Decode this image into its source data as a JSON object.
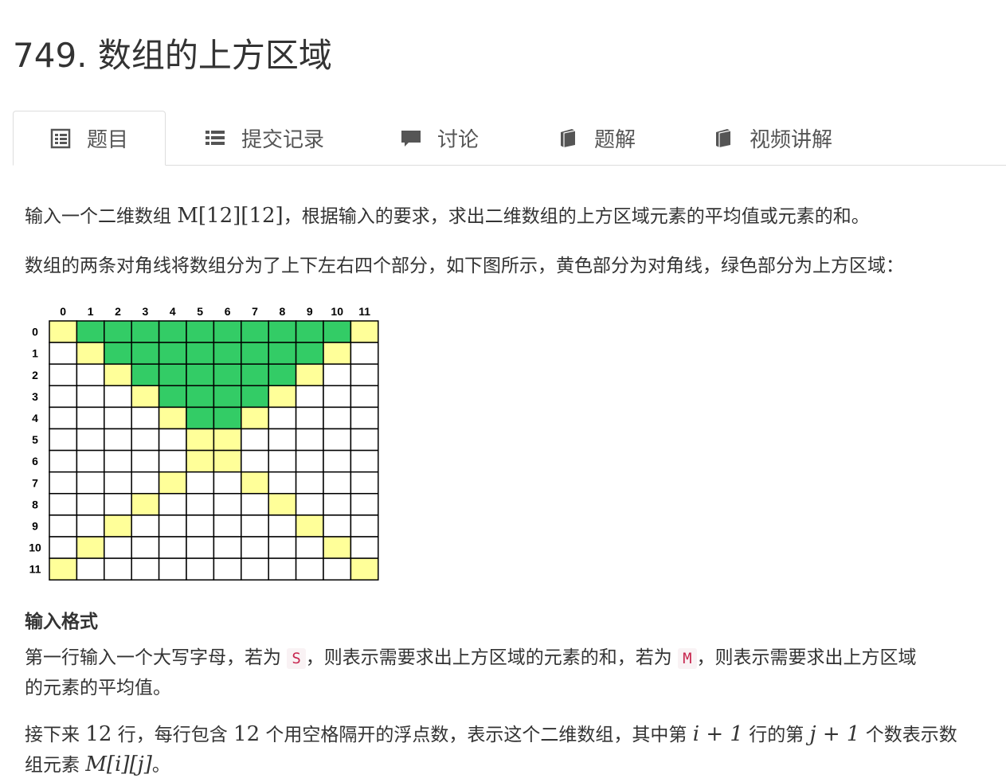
{
  "page": {
    "title": "749. 数组的上方区域"
  },
  "tabs": [
    {
      "label": "题目",
      "icon": "document-icon",
      "active": true
    },
    {
      "label": "提交记录",
      "icon": "list-icon",
      "active": false
    },
    {
      "label": "讨论",
      "icon": "comment-icon",
      "active": false
    },
    {
      "label": "题解",
      "icon": "book-icon",
      "active": false
    },
    {
      "label": "视频讲解",
      "icon": "book-icon",
      "active": false
    }
  ],
  "problem": {
    "p1_before": "输入一个二维数组 ",
    "p1_math": "M[12][12]",
    "p1_after": "，根据输入的要求，求出二维数组的上方区域元素的平均值或元素的和。",
    "p2": "数组的两条对角线将数组分为了上下左右四个部分，如下图所示，黄色部分为对角线，绿色部分为上方区域：",
    "input_heading": "输入格式",
    "p3_a": "第一行输入一个大写字母，若为 ",
    "p3_code1": "S",
    "p3_b": "，则表示需要求出上方区域的元素的和，若为 ",
    "p3_code2": "M",
    "p3_c": "，则表示需要求出上方区域",
    "p3_d": "的元素的平均值。",
    "p4_a": "接下来 ",
    "p4_n1": "12",
    "p4_b": " 行，每行包含 ",
    "p4_n2": "12",
    "p4_c": " 个用空格隔开的浮点数，表示这个二维数组，其中第 ",
    "p4_m1": "i + 1",
    "p4_d": " 行的第 ",
    "p4_m2": "j + 1",
    "p4_e": " 个数表示数",
    "p5_a": "组元素 ",
    "p5_m": "M[i][j]",
    "p5_b": "。"
  },
  "grid": {
    "size": 12,
    "col_labels": [
      "0",
      "1",
      "2",
      "3",
      "4",
      "5",
      "6",
      "7",
      "8",
      "9",
      "10",
      "11"
    ],
    "row_labels": [
      "0",
      "1",
      "2",
      "3",
      "4",
      "5",
      "6",
      "7",
      "8",
      "9",
      "10",
      "11"
    ],
    "colors": {
      "diagonal": "#ffff99",
      "upper": "#33cc66",
      "empty": "#ffffff",
      "line": "#000000"
    }
  }
}
